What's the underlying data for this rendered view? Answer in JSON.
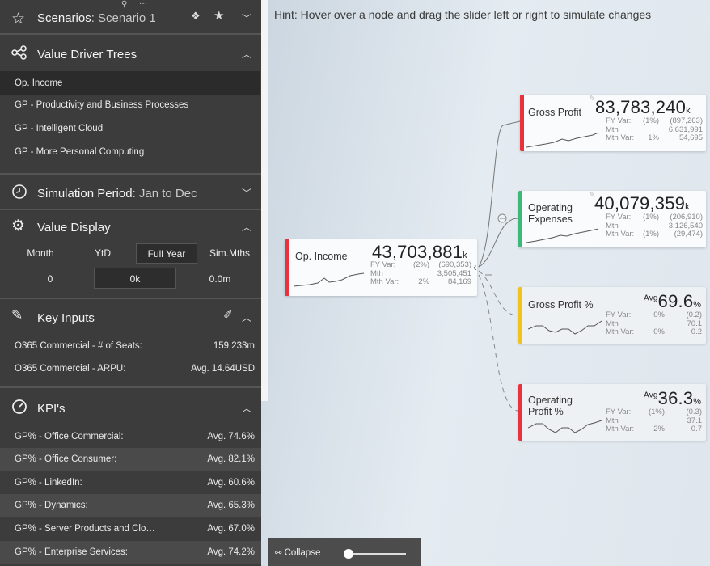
{
  "scenarios": {
    "label": "Scenarios",
    "value": ": Scenario 1"
  },
  "value_driver_trees": {
    "title": "Value Driver Trees",
    "items": [
      "Op. Income",
      "GP - Productivity and Business Processes",
      "GP - Intelligent Cloud",
      "GP - More Personal Computing"
    ]
  },
  "simulation_period": {
    "label": "Simulation Period",
    "value": ": Jan to Dec"
  },
  "value_display": {
    "title": "Value Display",
    "headers": [
      "Month",
      "YtD",
      "Full Year",
      "Sim.Mths"
    ],
    "values": [
      "0",
      "0k",
      "0.0m"
    ]
  },
  "key_inputs": {
    "title": "Key Inputs",
    "rows": [
      {
        "label": "O365 Commercial - # of Seats:",
        "value": "159.233m"
      },
      {
        "label": "O365 Commercial - ARPU:",
        "value": "Avg. 14.64USD"
      }
    ]
  },
  "kpis": {
    "title": "KPI's",
    "rows": [
      {
        "label": "GP% - Office Commercial:",
        "value": "Avg. 74.6%"
      },
      {
        "label": "GP% - Office Consumer:",
        "value": "Avg. 82.1%"
      },
      {
        "label": "GP% - LinkedIn:",
        "value": "Avg. 60.6%"
      },
      {
        "label": "GP% - Dynamics:",
        "value": "Avg. 65.3%"
      },
      {
        "label": "GP% - Server Products and Clo…",
        "value": "Avg. 67.0%"
      },
      {
        "label": "GP% - Enterprise Services:",
        "value": "Avg. 74.2%"
      }
    ]
  },
  "hint": "Hint: Hover over a node and drag the slider left or right to simulate changes",
  "nodes": {
    "op_income": {
      "name": "Op. Income",
      "value": "43,703,881",
      "unit": "k",
      "color": "#e8323c",
      "fy_var_label": "FY Var:",
      "fy_var_pct": "(2%)",
      "fy_var_abs": "(690,353)",
      "mth_label": "Mth",
      "mth_abs": "3,505,451",
      "mth_var_label": "Mth Var:",
      "mth_var_pct": "2%",
      "mth_var_abs": "84,169"
    },
    "gross_profit": {
      "name": "Gross Profit",
      "value": "83,783,240",
      "unit": "k",
      "color": "#e8323c",
      "fy_var_label": "FY Var:",
      "fy_var_pct": "(1%)",
      "fy_var_abs": "(897,263)",
      "mth_label": "Mth",
      "mth_abs": "6,631,991",
      "mth_var_label": "Mth Var:",
      "mth_var_pct": "1%",
      "mth_var_abs": "54,695"
    },
    "operating_expenses": {
      "name": "Operating Expenses",
      "value": "40,079,359",
      "unit": "k",
      "color": "#3cb878",
      "fy_var_label": "FY Var:",
      "fy_var_pct": "(1%)",
      "fy_var_abs": "(206,910)",
      "mth_label": "Mth",
      "mth_abs": "3,126,540",
      "mth_var_label": "Mth Var:",
      "mth_var_pct": "(1%)",
      "mth_var_abs": "(29,474)"
    },
    "gross_profit_pct": {
      "name": "Gross Profit %",
      "avg": "Avg",
      "value": "69.6",
      "unit": "%",
      "color": "#f2c31a",
      "fy_var_label": "FY Var:",
      "fy_var_pct": "0%",
      "fy_var_abs": "(0.2)",
      "mth_label": "Mth",
      "mth_abs": "70.1",
      "mth_var_label": "Mth Var:",
      "mth_var_pct": "0%",
      "mth_var_abs": "0.2"
    },
    "operating_profit_pct": {
      "name": "Operating Profit %",
      "avg": "Avg",
      "value": "36.3",
      "unit": "%",
      "color": "#e8323c",
      "fy_var_label": "FY Var:",
      "fy_var_pct": "(1%)",
      "fy_var_abs": "(0.3)",
      "mth_label": "Mth",
      "mth_abs": "37.1",
      "mth_var_label": "Mth Var:",
      "mth_var_pct": "2%",
      "mth_var_abs": "0.7"
    }
  },
  "collapse_label": "Collapse"
}
